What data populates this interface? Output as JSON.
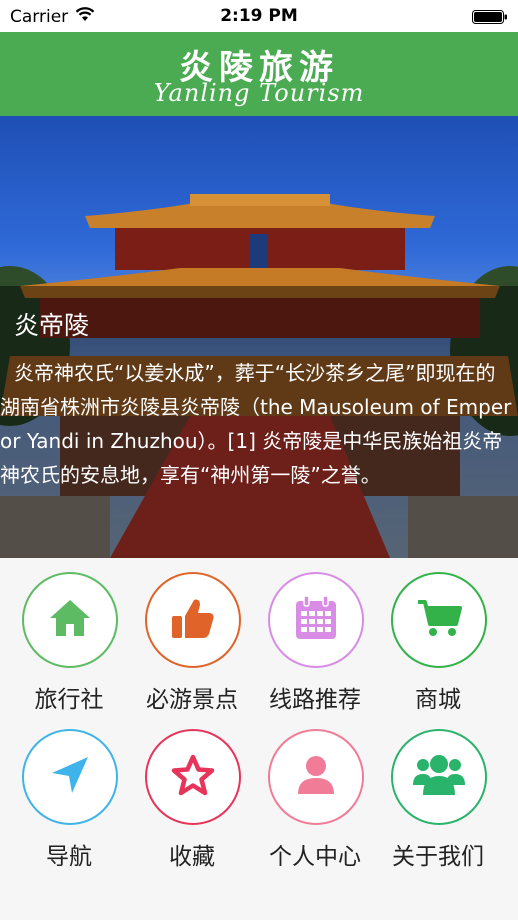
{
  "status_bar": {
    "carrier": "Carrier",
    "time": "2:19 PM"
  },
  "header": {
    "title_cn": "炎陵旅游",
    "title_en": "Yanling Tourism",
    "background": "#4aab52"
  },
  "hero": {
    "title": "炎帝陵",
    "description": "炎帝神农氏“以姜水成”，葬于“长沙茶乡之尾”即现在的湖南省株洲市炎陵县炎帝陵（the Mausoleum of Emperor Yandi in Zhuzhou）。[1] 炎帝陵是中华民族始祖炎帝神农氏的安息地，享有“神州第一陵”之誉。"
  },
  "grid": {
    "items": [
      {
        "label": "旅行社",
        "icon": "home-icon",
        "color": "#5dbb63"
      },
      {
        "label": "必游景点",
        "icon": "thumbs-up-icon",
        "color": "#e0642a"
      },
      {
        "label": "线路推荐",
        "icon": "calendar-icon",
        "color": "#d88ce6"
      },
      {
        "label": "商城",
        "icon": "shopping-cart-icon",
        "color": "#33b24a"
      },
      {
        "label": "导航",
        "icon": "navigation-arrow-icon",
        "color": "#3fb4ea"
      },
      {
        "label": "收藏",
        "icon": "star-icon",
        "color": "#e7345a"
      },
      {
        "label": "个人中心",
        "icon": "user-icon",
        "color": "#f07c97"
      },
      {
        "label": "关于我们",
        "icon": "group-icon",
        "color": "#2ab36a"
      }
    ]
  }
}
